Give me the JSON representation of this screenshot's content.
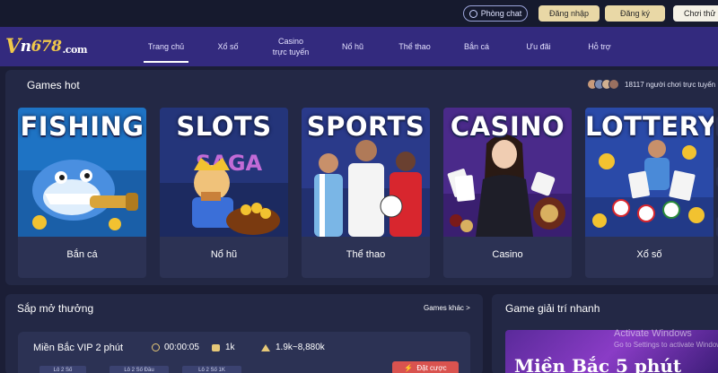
{
  "topbar": {
    "chat_label": "Phòng chat",
    "login_label": "Đăng nhập",
    "register_label": "Đăng ký",
    "trial_label": "Chơi thử"
  },
  "logo": {
    "v": "V",
    "n": "n",
    "num": "678",
    "domain": ".com"
  },
  "nav": {
    "items": [
      {
        "label": "Trang chủ",
        "sub": ""
      },
      {
        "label": "Xổ số",
        "sub": ""
      },
      {
        "label": "Casino",
        "sub": "trực tuyến"
      },
      {
        "label": "Nổ hũ",
        "sub": ""
      },
      {
        "label": "Thể thao",
        "sub": ""
      },
      {
        "label": "Bắn cá",
        "sub": ""
      },
      {
        "label": "Ưu đãi",
        "sub": ""
      },
      {
        "label": "Hỗ trợ",
        "sub": ""
      }
    ],
    "active_index": 0
  },
  "games_hot": {
    "title": "Games hot",
    "players_text": "18117 người chơi trực tuyến",
    "cards": [
      {
        "word": "FISHING",
        "label": "Bắn cá",
        "icon": "fishing-art"
      },
      {
        "word": "SLOTS",
        "label": "Nổ hũ",
        "icon": "slots-art"
      },
      {
        "word": "SPORTS",
        "label": "Thể thao",
        "icon": "sports-art"
      },
      {
        "word": "CASINO",
        "label": "Casino",
        "icon": "casino-art"
      },
      {
        "word": "LOTTERY",
        "label": "Xổ số",
        "icon": "lottery-art"
      }
    ]
  },
  "draw": {
    "title": "Sắp mở thưởng",
    "more_label": "Games khác >",
    "row": {
      "name": "Miền Bắc VIP 2 phút",
      "time": "00:00:05",
      "coin": "1k",
      "prize": "1.9k~8,880k",
      "bet_label": "Đặt cược",
      "chips": [
        "Lô 2 Số",
        "Lô 2 Số Đầu",
        "Lô 2 Số 1K"
      ]
    }
  },
  "quick": {
    "title": "Game giải trí nhanh",
    "banner_text": "Miền Bắc 5 phút"
  },
  "windows": {
    "line1": "Activate Windows",
    "line2": "Go to Settings to activate Windows."
  },
  "colors": {
    "background": "#1b1e36",
    "nav_bg": "#332a7e",
    "panel": "#232845",
    "card": "#2c3254",
    "gold_button": "#e9d8a6",
    "bet_red": "#d9534f"
  }
}
